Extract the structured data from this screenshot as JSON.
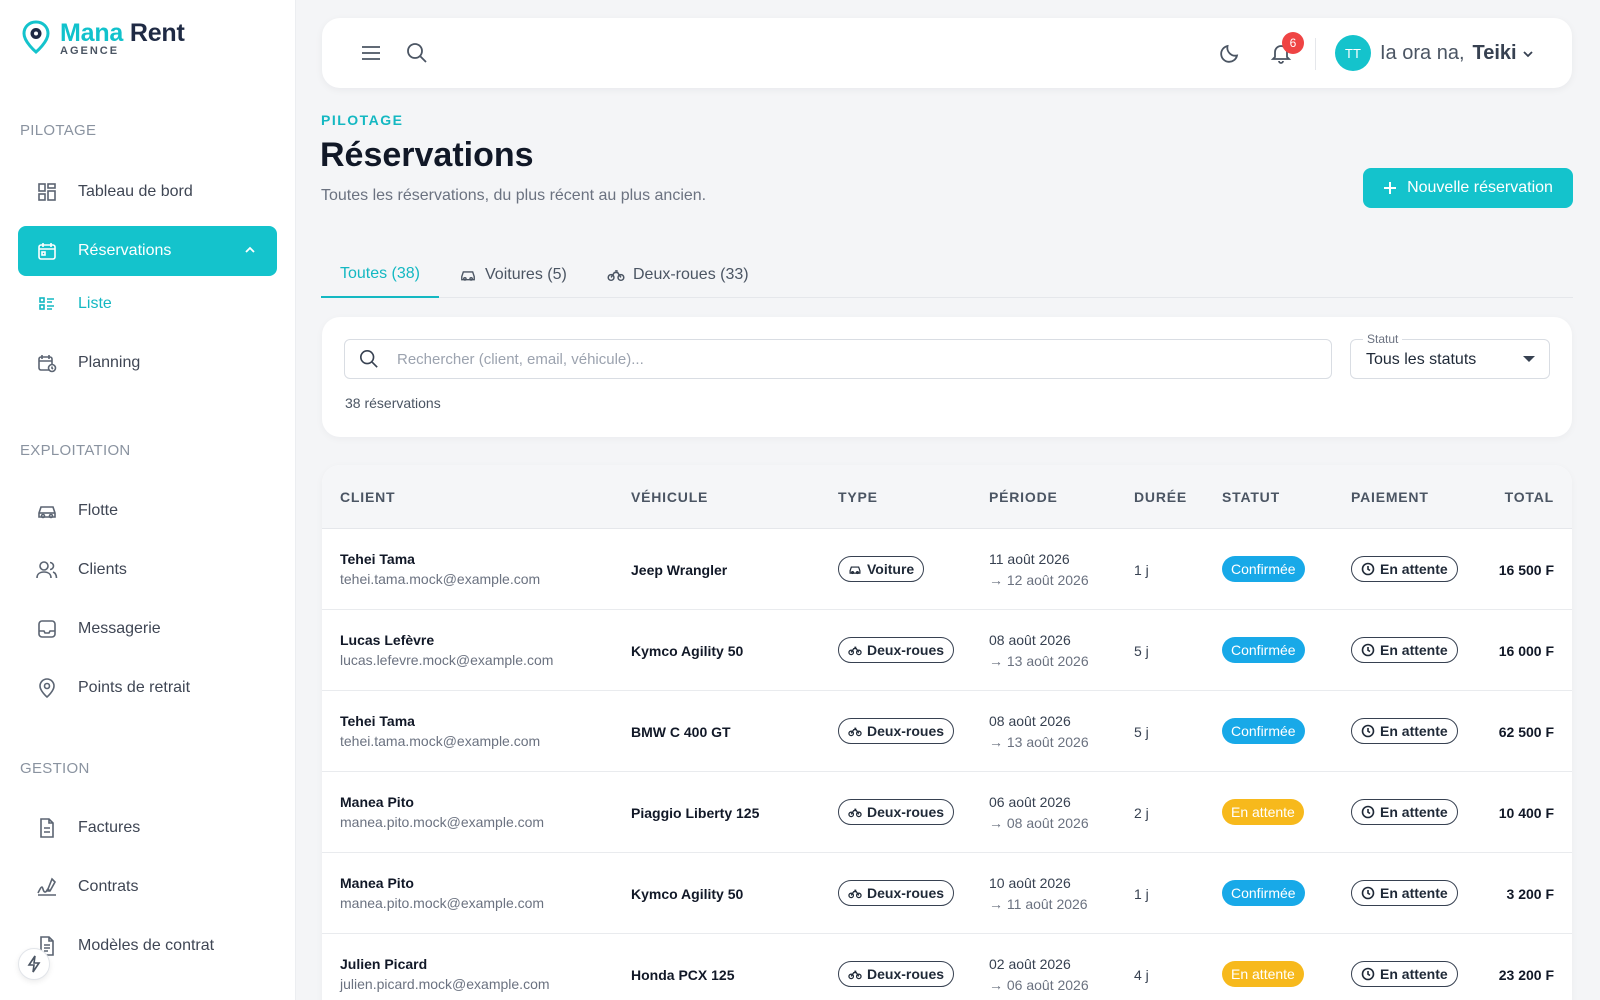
{
  "brand": {
    "name_a": "Mana",
    "name_b": " Rent",
    "sub": "AGENCE"
  },
  "colors": {
    "accent": "#14c3cc",
    "confirmed": "#18a9e8",
    "pending": "#f7b91c",
    "danger": "#ef4444"
  },
  "sidebar": {
    "sections": [
      {
        "title": "PILOTAGE",
        "items": [
          {
            "label": "Tableau de bord",
            "icon": "dashboard-icon"
          },
          {
            "label": "Réservations",
            "icon": "calendar-icon",
            "active": true
          },
          {
            "label": "Liste",
            "icon": "list-icon",
            "sub": true
          },
          {
            "label": "Planning",
            "icon": "calendar-clock-icon"
          }
        ]
      },
      {
        "title": "EXPLOITATION",
        "items": [
          {
            "label": "Flotte",
            "icon": "car-icon"
          },
          {
            "label": "Clients",
            "icon": "users-icon"
          },
          {
            "label": "Messagerie",
            "icon": "inbox-icon"
          },
          {
            "label": "Points de retrait",
            "icon": "location-pin-icon"
          }
        ]
      },
      {
        "title": "GESTION",
        "items": [
          {
            "label": "Factures",
            "icon": "invoice-icon"
          },
          {
            "label": "Contrats",
            "icon": "signature-icon"
          },
          {
            "label": "Modèles de contrat",
            "icon": "document-template-icon"
          }
        ]
      }
    ]
  },
  "topbar": {
    "notifications": "6",
    "avatar_initials": "TT",
    "greeting": "Ia ora na,",
    "user": "Teiki"
  },
  "header": {
    "crumb": "PILOTAGE",
    "title": "Réservations",
    "subtitle": "Toutes les réservations, du plus récent au plus ancien.",
    "new_button": "Nouvelle réservation"
  },
  "tabs": [
    {
      "label": "Toutes (38)",
      "active": true
    },
    {
      "label": "Voitures (5)",
      "icon": "car-icon"
    },
    {
      "label": "Deux-roues (33)",
      "icon": "motorbike-icon"
    }
  ],
  "filters": {
    "search_placeholder": "Rechercher (client, email, véhicule)...",
    "status_label": "Statut",
    "status_value": "Tous les statuts",
    "count": "38 réservations"
  },
  "table": {
    "columns": [
      "CLIENT",
      "VÉHICULE",
      "TYPE",
      "PÉRIODE",
      "DURÉE",
      "STATUT",
      "PAIEMENT",
      "TOTAL"
    ],
    "rows": [
      {
        "name": "Tehei Tama",
        "email": "tehei.tama.mock@example.com",
        "vehicle": "Jeep Wrangler",
        "type": "Voiture",
        "start": "11 août 2026",
        "end": "→ 12 août 2026",
        "duration": "1 j",
        "status": "Confirmée",
        "payment": "En attente",
        "total": "16 500 F"
      },
      {
        "name": "Lucas Lefèvre",
        "email": "lucas.lefevre.mock@example.com",
        "vehicle": "Kymco Agility 50",
        "type": "Deux-roues",
        "start": "08 août 2026",
        "end": "→ 13 août 2026",
        "duration": "5 j",
        "status": "Confirmée",
        "payment": "En attente",
        "total": "16 000 F"
      },
      {
        "name": "Tehei Tama",
        "email": "tehei.tama.mock@example.com",
        "vehicle": "BMW C 400 GT",
        "type": "Deux-roues",
        "start": "08 août 2026",
        "end": "→ 13 août 2026",
        "duration": "5 j",
        "status": "Confirmée",
        "payment": "En attente",
        "total": "62 500 F"
      },
      {
        "name": "Manea Pito",
        "email": "manea.pito.mock@example.com",
        "vehicle": "Piaggio Liberty 125",
        "type": "Deux-roues",
        "start": "06 août 2026",
        "end": "→ 08 août 2026",
        "duration": "2 j",
        "status": "En attente",
        "payment": "En attente",
        "total": "10 400 F"
      },
      {
        "name": "Manea Pito",
        "email": "manea.pito.mock@example.com",
        "vehicle": "Kymco Agility 50",
        "type": "Deux-roues",
        "start": "10 août 2026",
        "end": "→ 11 août 2026",
        "duration": "1 j",
        "status": "Confirmée",
        "payment": "En attente",
        "total": "3 200 F"
      },
      {
        "name": "Julien Picard",
        "email": "julien.picard.mock@example.com",
        "vehicle": "Honda PCX 125",
        "type": "Deux-roues",
        "start": "02 août 2026",
        "end": "→ 06 août 2026",
        "duration": "4 j",
        "status": "En attente",
        "payment": "En attente",
        "total": "23 200 F"
      }
    ]
  }
}
